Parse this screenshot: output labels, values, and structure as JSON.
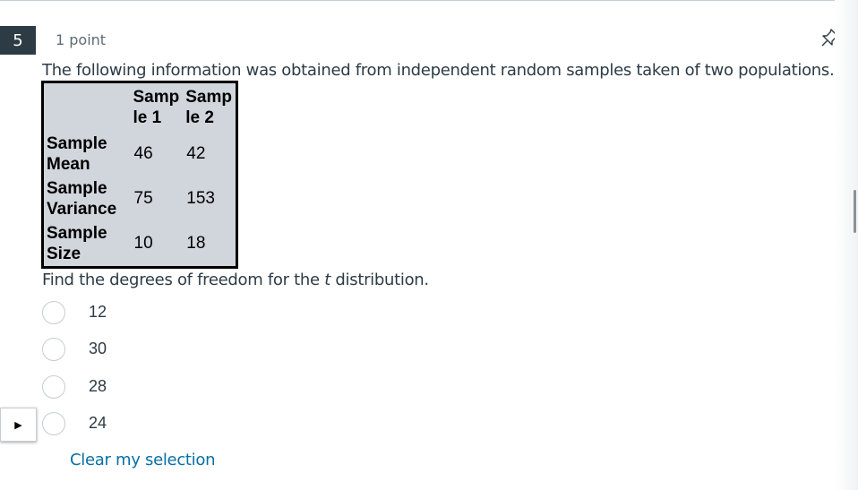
{
  "question": {
    "number": "5",
    "points": "1 point",
    "text": "The following information was obtained from independent random samples taken of two populations.",
    "prompt_before": "Find the degrees of freedom for the ",
    "prompt_italic": "t",
    "prompt_after": " distribution."
  },
  "table": {
    "col_headers": [
      "Samp le 1",
      "Samp le 2"
    ],
    "rows": [
      {
        "label": "Sample Mean",
        "values": [
          "46",
          "42"
        ]
      },
      {
        "label": "Sample Variance",
        "values": [
          "75",
          "153"
        ]
      },
      {
        "label": "Sample Size",
        "values": [
          "10",
          "18"
        ]
      }
    ]
  },
  "answers": [
    {
      "label": "12"
    },
    {
      "label": "30"
    },
    {
      "label": "28"
    },
    {
      "label": "24"
    }
  ],
  "clear_selection": "Clear my selection",
  "icons": {
    "pin": "pin-icon",
    "flag_marker": "triangle-right-icon"
  },
  "colors": {
    "number_badge_bg": "#2d3b45",
    "table_bg": "#d1d5dc",
    "link": "#0770a3",
    "text": "#2d3b45"
  }
}
